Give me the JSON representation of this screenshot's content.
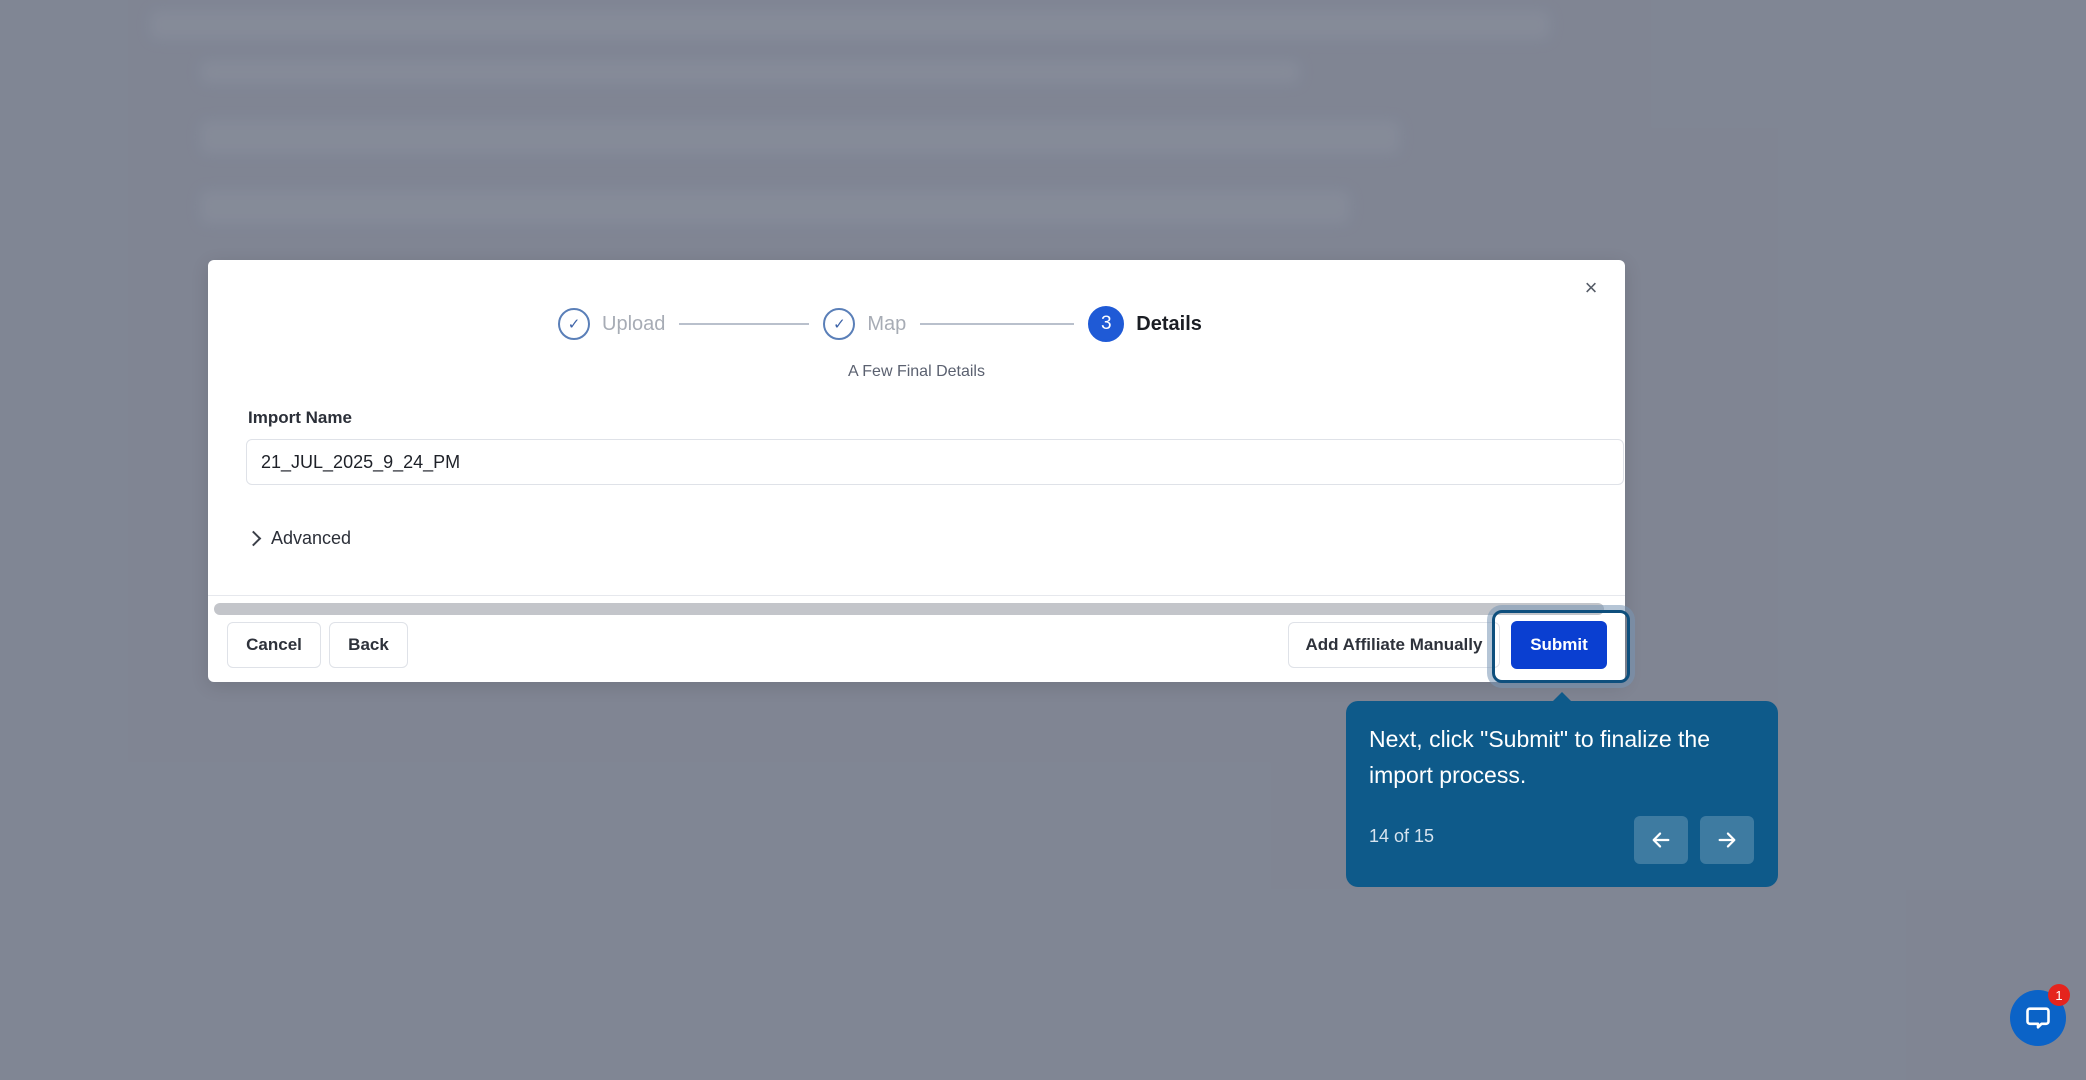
{
  "modal": {
    "close_label": "×",
    "steps": [
      {
        "label": "Upload",
        "marker": "✓",
        "state": "complete"
      },
      {
        "label": "Map",
        "marker": "✓",
        "state": "complete"
      },
      {
        "label": "Details",
        "marker": "3",
        "state": "active"
      }
    ],
    "subtitle": "A Few Final Details",
    "import_name": {
      "label": "Import Name",
      "value": "21_JUL_2025_9_24_PM"
    },
    "advanced_label": "Advanced",
    "footer": {
      "cancel_label": "Cancel",
      "back_label": "Back",
      "add_manually_label": "Add Affiliate Manually",
      "submit_label": "Submit"
    }
  },
  "tour": {
    "message": "Next, click \"Submit\" to finalize the import process.",
    "progress": "14 of 15",
    "prev_icon": "arrow-left-icon",
    "next_icon": "arrow-right-icon"
  },
  "chat": {
    "badge_count": "1"
  },
  "colors": {
    "primary": "#1f5ad6",
    "submit": "#0a3fd1",
    "tooltip_bg": "#0e5a8a",
    "badge": "#e5241d"
  }
}
